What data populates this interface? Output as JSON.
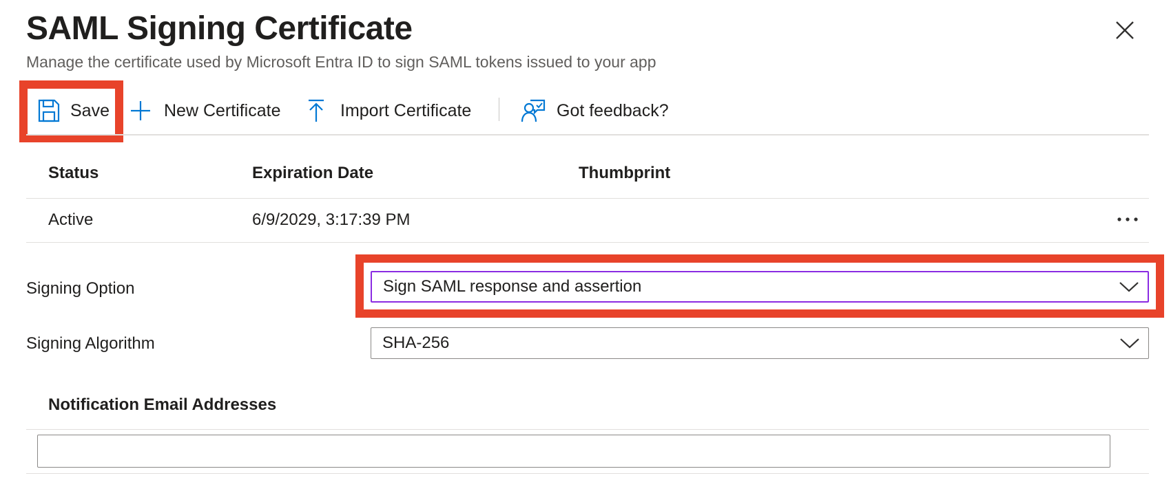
{
  "header": {
    "title": "SAML Signing Certificate",
    "subtitle": "Manage the certificate used by Microsoft Entra ID to sign SAML tokens issued to your app",
    "close_icon": "close-icon"
  },
  "toolbar": {
    "save_label": "Save",
    "new_certificate_label": "New Certificate",
    "import_certificate_label": "Import Certificate",
    "feedback_label": "Got feedback?",
    "icons": [
      "save-icon",
      "plus-icon",
      "upload-icon",
      "feedback-icon"
    ],
    "accent_color": "#0078d4",
    "highlight_color": "#e8432a"
  },
  "table": {
    "columns": [
      "Status",
      "Expiration Date",
      "Thumbprint"
    ],
    "rows": [
      {
        "status": "Active",
        "expiration_date": "6/9/2029, 3:17:39 PM",
        "thumbprint": ""
      }
    ]
  },
  "form": {
    "signing_option": {
      "label": "Signing Option",
      "value": "Sign SAML response and assertion"
    },
    "signing_algorithm": {
      "label": "Signing Algorithm",
      "value": "SHA-256"
    },
    "notification": {
      "heading": "Notification Email Addresses",
      "value": ""
    }
  }
}
